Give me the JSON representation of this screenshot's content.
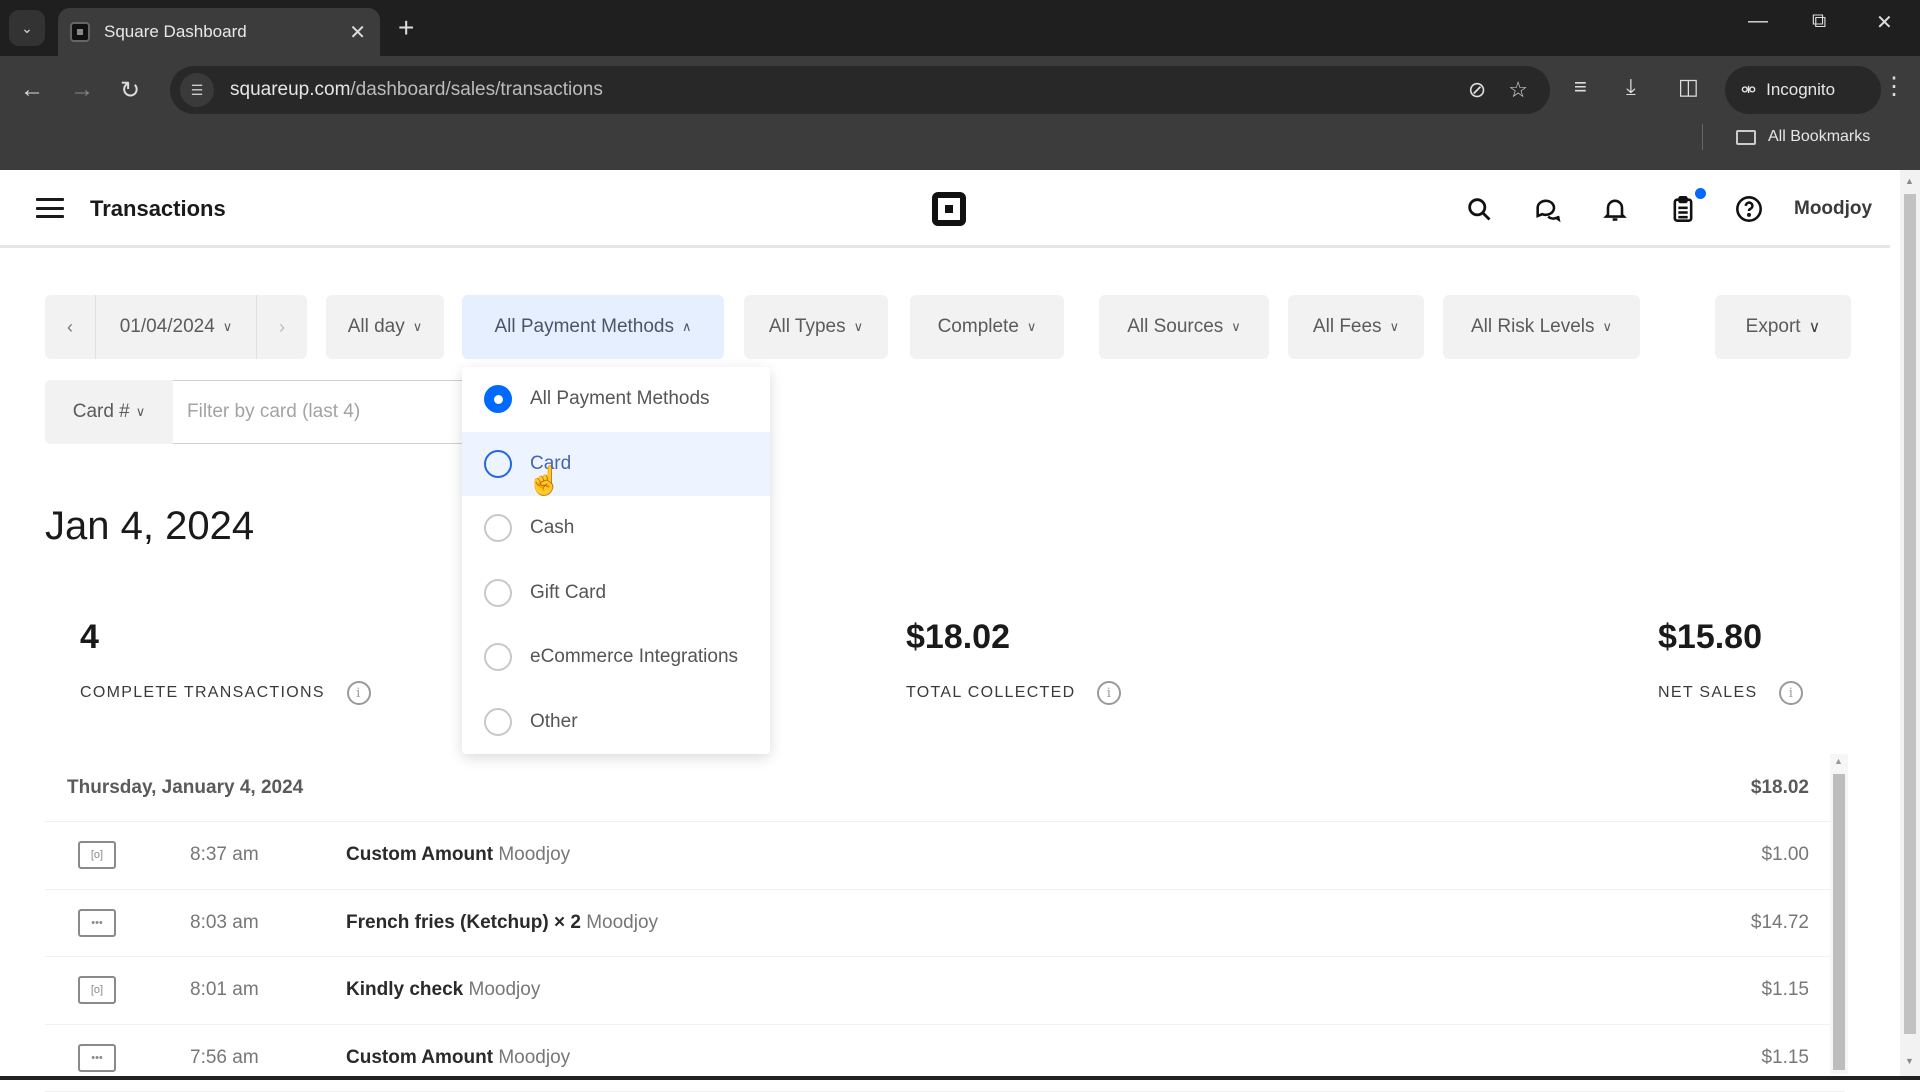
{
  "browser": {
    "tab_title": "Square Dashboard",
    "url_host": "squareup.com",
    "url_path": "/dashboard/sales/transactions",
    "incognito_label": "Incognito",
    "bookmarks_label": "All Bookmarks"
  },
  "header": {
    "title": "Transactions",
    "user_name": "Moodjoy",
    "accent_color": "#006aff"
  },
  "filters": {
    "date": "01/04/2024",
    "time_range": "All day",
    "payment_methods": "All Payment Methods",
    "types": "All Types",
    "status": "Complete",
    "sources": "All Sources",
    "fees": "All Fees",
    "risk_levels": "All Risk Levels",
    "export": "Export",
    "card_filter_label": "Card #",
    "card_input_placeholder": "Filter by card (last 4)",
    "card_input_value": ""
  },
  "payment_dropdown": {
    "options": [
      {
        "label": "All Payment Methods",
        "selected": true
      },
      {
        "label": "Card",
        "selected": false,
        "hovered": true
      },
      {
        "label": "Cash",
        "selected": false
      },
      {
        "label": "Gift Card",
        "selected": false
      },
      {
        "label": "eCommerce Integrations",
        "selected": false
      },
      {
        "label": "Other",
        "selected": false
      }
    ]
  },
  "summary": {
    "date_heading": "Jan 4, 2024",
    "complete_transactions": {
      "value": "4",
      "label": "COMPLETE TRANSACTIONS"
    },
    "total_collected": {
      "value": "$18.02",
      "label": "TOTAL COLLECTED"
    },
    "net_sales": {
      "value": "$15.80",
      "label": "NET SALES"
    }
  },
  "transactions": {
    "group_date": "Thursday, January 4, 2024",
    "group_total": "$18.02",
    "rows": [
      {
        "icon": "cash-icon",
        "time": "8:37 am",
        "item": "Custom Amount",
        "location": "Moodjoy",
        "amount": "$1.00"
      },
      {
        "icon": "other-payment-icon",
        "time": "8:03 am",
        "item": "French fries (Ketchup) × 2",
        "location": "Moodjoy",
        "amount": "$14.72"
      },
      {
        "icon": "cash-icon",
        "time": "8:01 am",
        "item": "Kindly check",
        "location": "Moodjoy",
        "amount": "$1.15"
      },
      {
        "icon": "other-payment-icon",
        "time": "7:56 am",
        "item": "Custom Amount",
        "location": "Moodjoy",
        "amount": "$1.15"
      }
    ]
  }
}
